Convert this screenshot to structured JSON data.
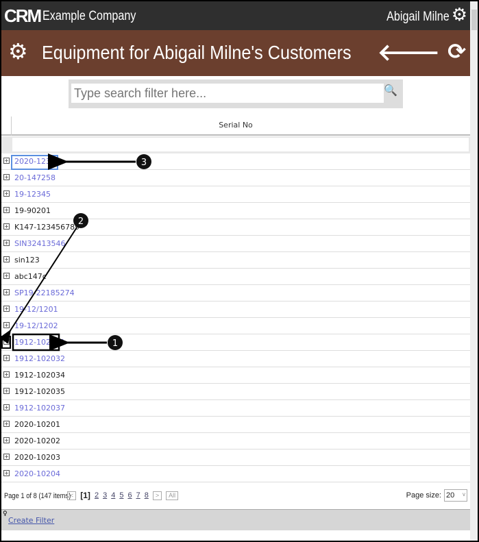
{
  "app": {
    "logo": "CRM",
    "company": "Example Company",
    "user": "Abigail Milne"
  },
  "page": {
    "title": "Equipment for Abigail Milne's Customers"
  },
  "search": {
    "placeholder": "Type search filter here..."
  },
  "grid": {
    "column": "Serial No",
    "rows": [
      {
        "serial": "2020-12345",
        "link": true
      },
      {
        "serial": "20-147258",
        "link": true
      },
      {
        "serial": "19-12345",
        "link": true
      },
      {
        "serial": "19-90201",
        "link": false
      },
      {
        "serial": "K147-123456789",
        "link": false
      },
      {
        "serial": "SIN32413546",
        "link": true
      },
      {
        "serial": "sin123",
        "link": false
      },
      {
        "serial": "abc147c",
        "link": false
      },
      {
        "serial": "SP19-22185274",
        "link": true
      },
      {
        "serial": "19-12/1201",
        "link": true
      },
      {
        "serial": "19-12/1202",
        "link": true
      },
      {
        "serial": "1912-102031",
        "link": true
      },
      {
        "serial": "1912-102032",
        "link": true
      },
      {
        "serial": "1912-102034",
        "link": false
      },
      {
        "serial": "1912-102035",
        "link": false
      },
      {
        "serial": "1912-102037",
        "link": true
      },
      {
        "serial": "2020-10201",
        "link": false
      },
      {
        "serial": "2020-10202",
        "link": false
      },
      {
        "serial": "2020-10203",
        "link": false
      },
      {
        "serial": "2020-10204",
        "link": true
      }
    ]
  },
  "pager": {
    "info": "Page 1 of 8 (147 items)",
    "prev": "<",
    "current": "[1]",
    "pages": [
      "2",
      "3",
      "4",
      "5",
      "6",
      "7",
      "8"
    ],
    "next": ">",
    "all": "All",
    "size_label": "Page size:",
    "size": "20"
  },
  "footer": {
    "create_filter": "Create Filter"
  },
  "annotations": [
    "1",
    "2",
    "3"
  ]
}
